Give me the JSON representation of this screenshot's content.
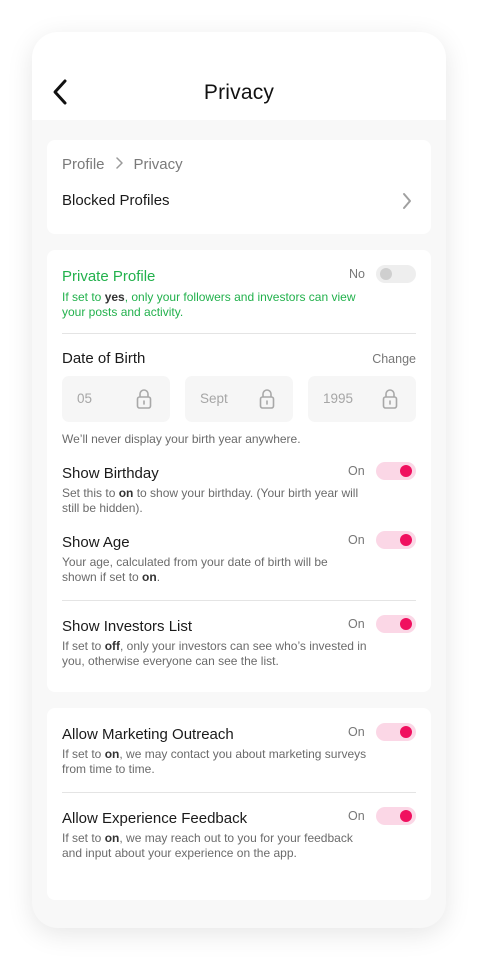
{
  "header": {
    "title": "Privacy",
    "back_icon": "chevron-left-icon"
  },
  "nav_card": {
    "breadcrumb": [
      "Profile",
      "Privacy"
    ],
    "blocked_label": "Blocked Profiles"
  },
  "colors": {
    "accent_pink": "#f0105f",
    "green": "#22b14c"
  },
  "private_profile": {
    "label": "Private Profile",
    "state": "No",
    "enabled": false,
    "desc_pre": "If set to ",
    "desc_bold": "yes",
    "desc_post": ", only your followers and investors can view your posts and activity."
  },
  "dob": {
    "label": "Date of Birth",
    "change_label": "Change",
    "day": "05",
    "month": "Sept",
    "year": "1995",
    "note": "We’ll never display your birth year anywhere."
  },
  "show_birthday": {
    "label": "Show Birthday",
    "state": "On",
    "enabled": true,
    "desc_pre": "Set this to ",
    "desc_bold": "on",
    "desc_post": " to show your birthday. (Your birth year will still be hidden)."
  },
  "show_age": {
    "label": "Show Age",
    "state": "On",
    "enabled": true,
    "desc_pre": "Your age, calculated from your date of birth will be shown if set to ",
    "desc_bold": "on",
    "desc_post": "."
  },
  "show_investors": {
    "label": "Show Investors List",
    "state": "On",
    "enabled": true,
    "desc_pre": "If set to ",
    "desc_bold": "off",
    "desc_post": ", only your investors can see who’s invested in you, otherwise everyone can see the list."
  },
  "marketing": {
    "label": "Allow Marketing Outreach",
    "state": "On",
    "enabled": true,
    "desc_pre": "If set to ",
    "desc_bold": "on",
    "desc_post": ", we may contact you about marketing surveys from time to time."
  },
  "feedback": {
    "label": "Allow Experience Feedback",
    "state": "On",
    "enabled": true,
    "desc_pre": "If set to ",
    "desc_bold": "on",
    "desc_post": ", we may reach out to you for your feedback and input about your experience on the app."
  }
}
